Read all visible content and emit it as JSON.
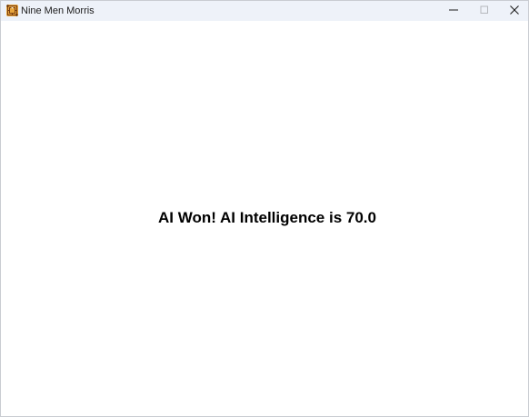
{
  "window": {
    "title": "Nine Men Morris",
    "icon": "nine-mens-morris-board-icon"
  },
  "controls": {
    "minimize_icon": "minimize-icon",
    "maximize_icon": "maximize-icon",
    "close_icon": "close-icon"
  },
  "game": {
    "result_message": "AI Won! AI Intelligence is 70.0"
  },
  "colors": {
    "titlebar_bg": "#eef2f9",
    "content_bg": "#ffffff",
    "text": "#000000"
  }
}
